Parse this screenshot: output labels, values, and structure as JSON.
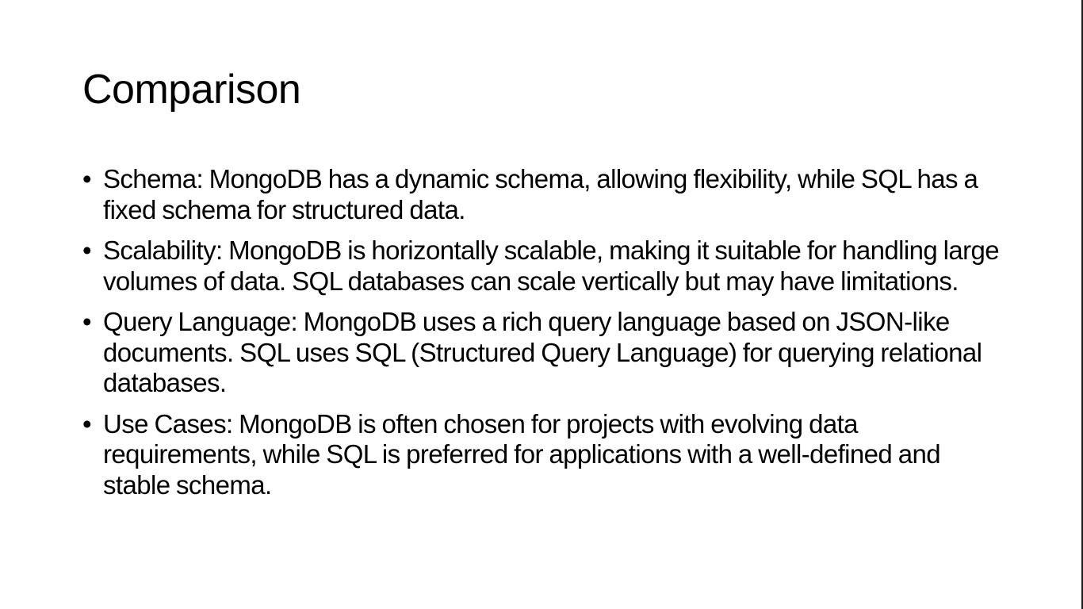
{
  "slide": {
    "title": "Comparison",
    "bullets": [
      {
        "marker": "•",
        "text": "Schema: MongoDB has a dynamic schema, allowing flexibility, while SQL has a fixed schema for structured data."
      },
      {
        "marker": "•",
        "text": "Scalability: MongoDB is horizontally scalable, making it suitable for handling large volumes of data. SQL databases can scale vertically but may have limitations."
      },
      {
        "marker": "•",
        "text": "Query Language: MongoDB uses a rich query language based on JSON-like documents. SQL uses SQL (Structured Query Language) for querying relational databases."
      },
      {
        "marker": "•",
        "text": "Use Cases: MongoDB is often chosen for projects with evolving data requirements, while SQL is preferred for applications with a well-defined and stable schema."
      }
    ]
  }
}
